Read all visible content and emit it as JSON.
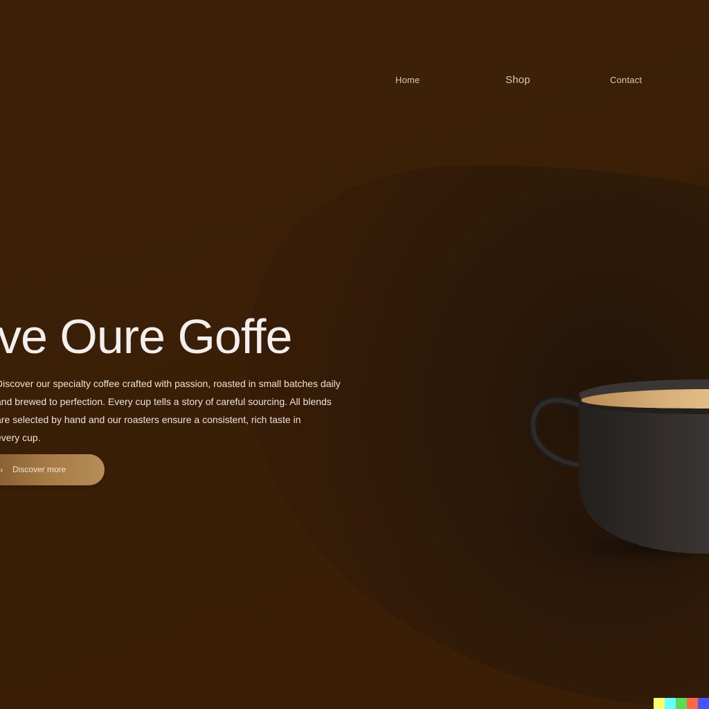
{
  "nav": {
    "items": [
      {
        "label": "Home"
      },
      {
        "label": "Shop"
      },
      {
        "label": "Contact"
      }
    ]
  },
  "hero": {
    "title": "ve Oure Goffe",
    "body_lines": [
      "Discover our specialty coffee crafted with passion, roasted in small batches daily",
      "and brewed to perfection. Every cup tells a story of careful sourcing. All blends",
      "are selected by hand and our roasters ensure a consistent, rich taste in",
      "every cup."
    ],
    "cta_label": "Discover more"
  },
  "cup_icon": "coffee-cup-icon",
  "colors": {
    "background": "#3a1f07",
    "accent_gold": "#a57a45",
    "title_text": "#f2f0ee",
    "cup_body": "#2a2624",
    "coffee_surface": "#c9a06a",
    "strip": [
      "#ffff66",
      "#66ffff",
      "#55dd55",
      "#ff6644",
      "#4455ff"
    ]
  }
}
